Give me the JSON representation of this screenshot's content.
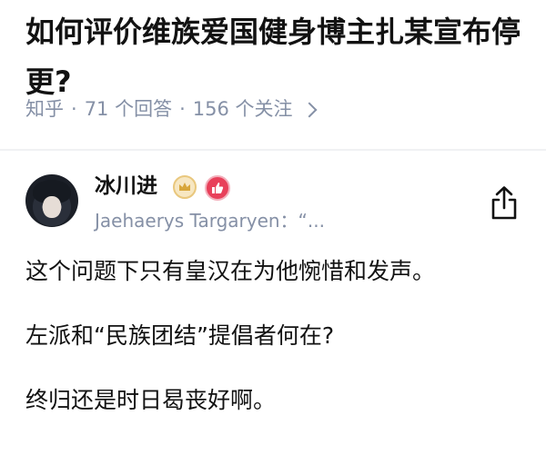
{
  "question": {
    "title": "如何评价维族爱国健身博主扎某宣布停更?",
    "meta": {
      "source": "知乎",
      "answers": "71 个回答",
      "follows": "156 个关注"
    }
  },
  "answer": {
    "author": {
      "name": "冰川进",
      "subtitle": "Jaehaerys Targaryen：“..."
    },
    "paragraphs": [
      "这个问题下只有皇汉在为他惋惜和发声。",
      "左派和“民族团结”提倡者何在?",
      "终归还是时日曷丧好啊。"
    ]
  },
  "icons": {
    "crown_badge": "crown-badge-icon",
    "like_badge": "thumbs-up-badge-icon",
    "share": "share-icon",
    "chevron": "chevron-right-icon"
  },
  "colors": {
    "text_primary": "#121212",
    "text_secondary": "#8590a6",
    "like_badge": "#e8405a",
    "crown_badge": "#e9c77d"
  }
}
